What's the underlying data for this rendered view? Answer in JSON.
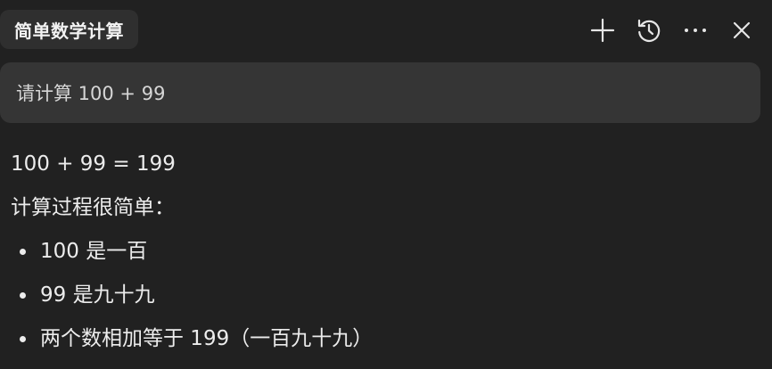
{
  "header": {
    "title": "简单数学计算",
    "actions": [
      {
        "name": "new-chat",
        "icon": "plus-icon"
      },
      {
        "name": "history",
        "icon": "history-icon"
      },
      {
        "name": "more",
        "icon": "more-horizontal-icon"
      },
      {
        "name": "close",
        "icon": "close-icon"
      }
    ]
  },
  "user_message": {
    "text": "请计算 100 + 99"
  },
  "assistant_message": {
    "result_line": "100 + 99 = 199",
    "intro_line": "计算过程很简单：",
    "bullets": [
      "100 是一百",
      "99 是九十九",
      "两个数相加等于 199（一百九十九）"
    ]
  },
  "colors": {
    "background": "#212121",
    "title_chip": "#2f2f2f",
    "user_bubble": "#353535",
    "text": "#ececec"
  }
}
